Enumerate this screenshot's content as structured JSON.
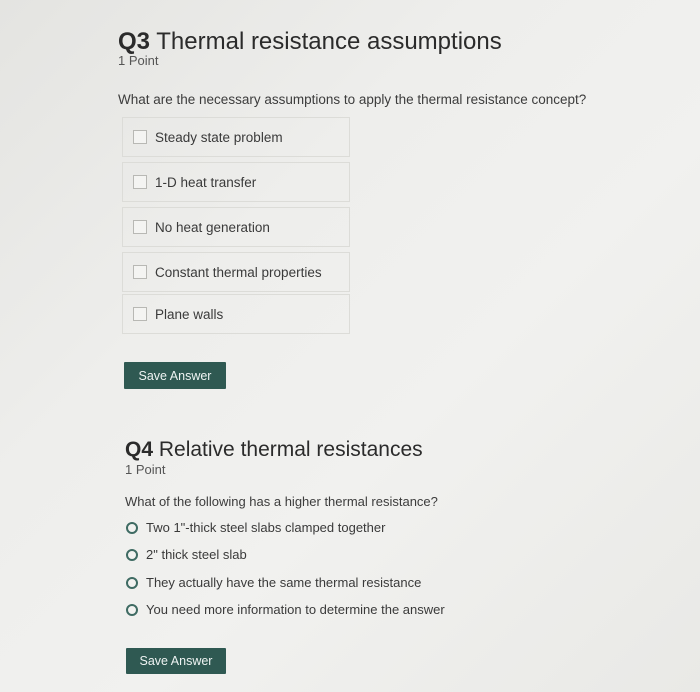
{
  "q3": {
    "number": "Q3",
    "title": "Thermal resistance assumptions",
    "points": "1 Point",
    "prompt": "What are the necessary assumptions to apply the thermal resistance concept?",
    "options": [
      {
        "label": "Steady state problem",
        "checked": false
      },
      {
        "label": "1-D heat transfer",
        "checked": false
      },
      {
        "label": "No heat generation",
        "checked": false
      },
      {
        "label": "Constant thermal properties",
        "checked": false
      },
      {
        "label": "Plane walls",
        "checked": false
      }
    ],
    "save_label": "Save Answer"
  },
  "q4": {
    "number": "Q4",
    "title": "Relative thermal resistances",
    "points": "1 Point",
    "prompt": "What of the following has a higher thermal resistance?",
    "options": [
      {
        "label": "Two 1\"-thick steel slabs clamped together",
        "selected": false
      },
      {
        "label": "2\" thick steel slab",
        "selected": false
      },
      {
        "label": "They actually have the same thermal resistance",
        "selected": false
      },
      {
        "label": "You need more information to determine the answer",
        "selected": false
      }
    ],
    "save_label": "Save Answer"
  },
  "colors": {
    "button_bg": "#2f5952",
    "radio_border": "#3f6b63"
  }
}
